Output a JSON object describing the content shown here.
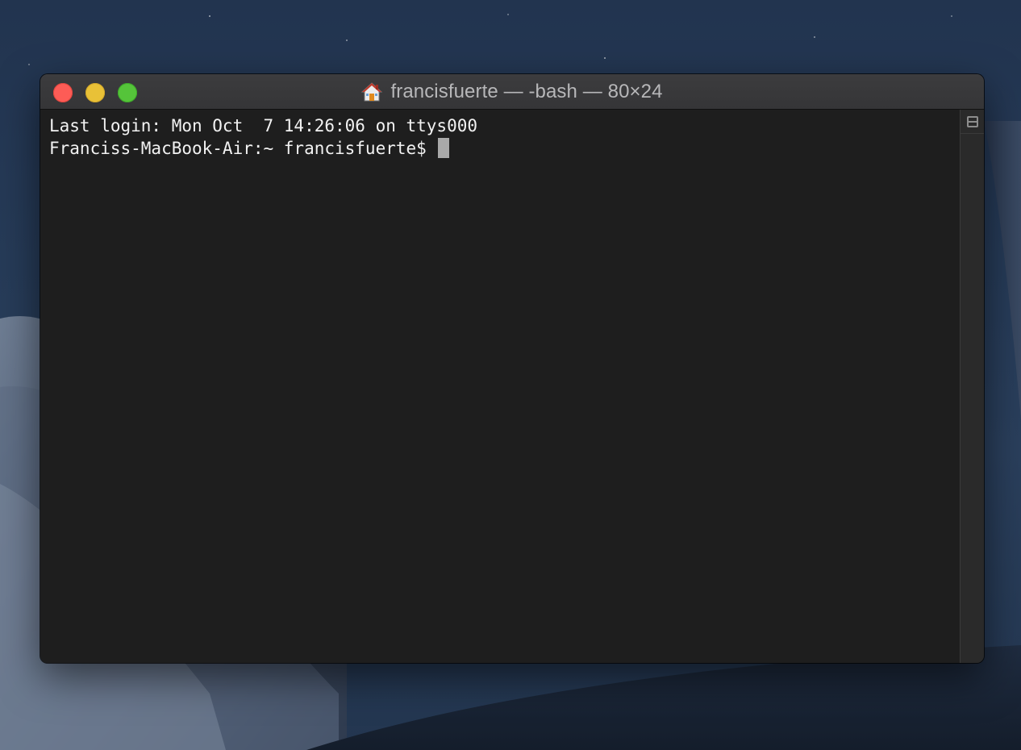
{
  "window": {
    "title": "francisfuerte — -bash — 80×24",
    "title_icon": "home-folder-icon",
    "controls": {
      "close": "close-button",
      "minimize": "minimize-button",
      "zoom": "zoom-button"
    }
  },
  "terminal": {
    "lines": [
      "Last login: Mon Oct  7 14:26:06 on ttys000",
      "Franciss-MacBook-Air:~ francisfuerte$"
    ]
  },
  "scrollbar": {
    "split_icon": "split-pane-icon"
  },
  "colors": {
    "terminal_bg": "#1e1e1e",
    "terminal_text": "#f2f2f2",
    "cursor": "#a9a9a9",
    "close": "#fd5c56",
    "minimize": "#e9c137",
    "zoom": "#55c43a"
  }
}
